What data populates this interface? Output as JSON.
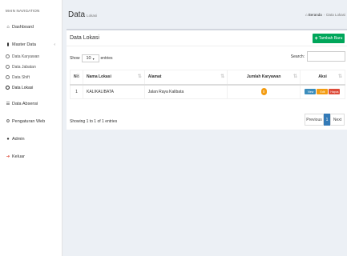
{
  "sidebar": {
    "brand": "MAIN NAVIGATION",
    "dashboard": "Dashboard",
    "master_data": "Master Data",
    "sub": [
      "Data Karyawan",
      "Data Jabatan",
      "Data Shift",
      "Data Lokasi"
    ],
    "data_absensi": "Data Absensi",
    "pengaturan_web": "Pengaturan Web",
    "admin": "Admin",
    "keluar": "Keluar"
  },
  "header": {
    "title": "Data",
    "subtitle": "Lokasi",
    "breadcrumb_home": "Beranda",
    "breadcrumb_current": "Data Lokasi"
  },
  "box": {
    "title": "Data Lokasi",
    "add_button": "Tambah Baru"
  },
  "controls": {
    "show_label": "Show",
    "entries_value": "10",
    "entries_label": "entries",
    "search_label": "Search:"
  },
  "table": {
    "headers": [
      "No",
      "Nama Lokasi",
      "Alamat",
      "Jumlah Karyawan",
      "Aksi"
    ],
    "rows": [
      {
        "no": "1",
        "nama": "KALIKALIBATA",
        "alamat": "Jalan Raya Kalibata",
        "jumlah": "0"
      }
    ],
    "actions": {
      "view": "View",
      "edit": "Edit",
      "hapus": "Hapus"
    }
  },
  "footer": {
    "info": "Showing 1 to 1 of 1 entries",
    "previous": "Previous",
    "page": "1",
    "next": "Next"
  }
}
